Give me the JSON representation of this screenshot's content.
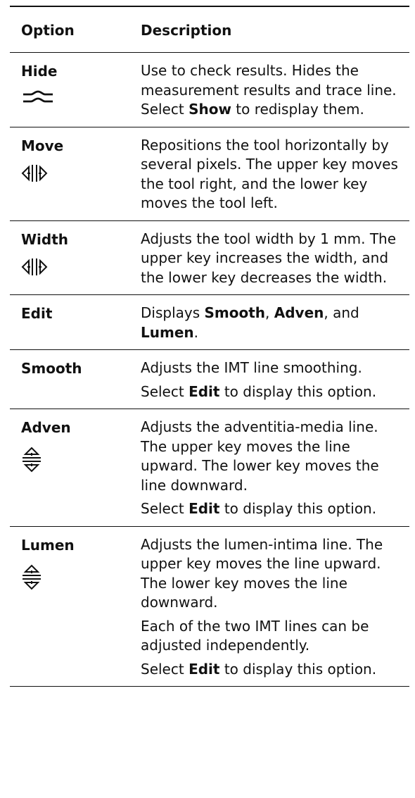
{
  "header": {
    "option": "Option",
    "description": "Description"
  },
  "rows": [
    {
      "option": "Hide",
      "icon": "hide-trace-icon",
      "description": [
        {
          "segments": [
            {
              "text": "Use to check results. Hides the measurement results and trace line. Select ",
              "bold": false
            },
            {
              "text": "Show",
              "bold": true
            },
            {
              "text": " to redisplay them.",
              "bold": false
            }
          ]
        }
      ]
    },
    {
      "option": "Move",
      "icon": "left-right-arrows-icon",
      "description": [
        {
          "segments": [
            {
              "text": "Repositions the tool horizontally by several pixels. The upper key moves the tool right, and the lower key moves the tool left.",
              "bold": false
            }
          ]
        }
      ]
    },
    {
      "option": "Width",
      "icon": "left-right-arrows-icon",
      "description": [
        {
          "segments": [
            {
              "text": "Adjusts the tool width by 1 mm. The upper key increases the width, and the lower key decreases the width.",
              "bold": false
            }
          ]
        }
      ]
    },
    {
      "option": "Edit",
      "icon": "",
      "description": [
        {
          "segments": [
            {
              "text": "Displays ",
              "bold": false
            },
            {
              "text": "Smooth",
              "bold": true
            },
            {
              "text": ", ",
              "bold": false
            },
            {
              "text": "Adven",
              "bold": true
            },
            {
              "text": ", and ",
              "bold": false
            },
            {
              "text": "Lumen",
              "bold": true
            },
            {
              "text": ".",
              "bold": false
            }
          ]
        }
      ]
    },
    {
      "option": "Smooth",
      "icon": "",
      "description": [
        {
          "segments": [
            {
              "text": "Adjusts the IMT line smoothing.",
              "bold": false
            }
          ]
        },
        {
          "segments": [
            {
              "text": "Select ",
              "bold": false
            },
            {
              "text": "Edit",
              "bold": true
            },
            {
              "text": " to display this option.",
              "bold": false
            }
          ]
        }
      ]
    },
    {
      "option": "Adven",
      "icon": "up-down-arrows-icon",
      "description": [
        {
          "segments": [
            {
              "text": "Adjusts the adventitia-media line. The upper key moves the line upward. The lower key moves the line downward.",
              "bold": false
            }
          ]
        },
        {
          "segments": [
            {
              "text": "Select ",
              "bold": false
            },
            {
              "text": "Edit",
              "bold": true
            },
            {
              "text": " to display this option.",
              "bold": false
            }
          ]
        }
      ]
    },
    {
      "option": "Lumen",
      "icon": "up-down-arrows-icon",
      "description": [
        {
          "segments": [
            {
              "text": "Adjusts the lumen-intima line. The upper key moves the line upward. The lower key moves the line downward.",
              "bold": false
            }
          ]
        },
        {
          "segments": [
            {
              "text": "Each of the two IMT lines can be adjusted independently.",
              "bold": false
            }
          ]
        },
        {
          "segments": [
            {
              "text": "Select ",
              "bold": false
            },
            {
              "text": "Edit",
              "bold": true
            },
            {
              "text": " to display this option.",
              "bold": false
            }
          ]
        }
      ]
    }
  ]
}
